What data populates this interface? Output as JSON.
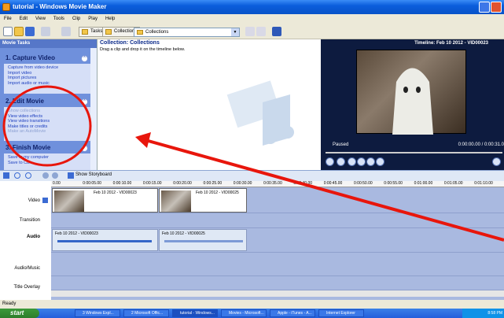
{
  "window": {
    "title": "tutorial - Windows Movie Maker"
  },
  "menu": [
    "File",
    "Edit",
    "View",
    "Tools",
    "Clip",
    "Play",
    "Help"
  ],
  "toolbar": {
    "tasks_label": "Tasks",
    "collections_label": "Collections",
    "collections_select": "Collections"
  },
  "taskpane": {
    "header": "Movie Tasks",
    "sections": [
      {
        "title": "1. Capture Video",
        "items": [
          {
            "label": "Capture from video device",
            "disabled": false
          },
          {
            "label": "Import video",
            "disabled": false
          },
          {
            "label": "Import pictures",
            "disabled": false
          },
          {
            "label": "Import audio or music",
            "disabled": false
          }
        ]
      },
      {
        "title": "2. Edit Movie",
        "items": [
          {
            "label": "Show collections",
            "disabled": true
          },
          {
            "label": "View video effects",
            "disabled": false
          },
          {
            "label": "View video transitions",
            "disabled": false
          },
          {
            "label": "Make titles or credits",
            "disabled": false
          },
          {
            "label": "Make an AutoMovie",
            "disabled": true
          }
        ]
      },
      {
        "title": "3. Finish Movie",
        "items": [
          {
            "label": "Save to my computer",
            "disabled": false
          },
          {
            "label": "Save to CD",
            "disabled": false
          }
        ]
      }
    ]
  },
  "content": {
    "title": "Collection: Collections",
    "subtitle": "Drag a clip and drop it on the timeline below."
  },
  "monitor": {
    "title": "Timeline: Feb 10 2012 - VID00023",
    "status": "Paused",
    "time": "0:00:00.00 / 0:00:31.0"
  },
  "storyboard": {
    "toggle_label": "Show Storyboard"
  },
  "ruler": [
    "0.00",
    "0:00:05.00",
    "0:00:10.00",
    "0:00:15.00",
    "0:00:20.00",
    "0:00:25.00",
    "0:00:30.00",
    "0:00:35.00",
    "0:00:40.00",
    "0:00:45.00",
    "0:00:50.00",
    "0:00:55.00",
    "0:01:00.00",
    "0:01:05.00",
    "0:01:10.00"
  ],
  "tracks": {
    "video": "Video",
    "transition": "Transition",
    "audio": "Audio",
    "audio_music": "Audio/Music",
    "title_overlay": "Title Overlay"
  },
  "clips": {
    "video1": "Feb 10 2012 - VID00023",
    "video2": "Feb 10 2012 - VID00025",
    "audio1": "Feb 10 2012 - VID00023",
    "audio2": "Feb 10 2012 - VID00025"
  },
  "status": "Ready",
  "taskbar": {
    "start": "start",
    "items": [
      "3 Windows Expl...",
      "2 Microsoft Offic...",
      "tutorial - Windows...",
      "Movies - Microsoft...",
      "Apple - iTunes - A...",
      "Internet Explorer"
    ],
    "clock": "8:58 PM"
  },
  "colors": {
    "annotation": "#e8160c",
    "titlebar": "#0a5ddc"
  }
}
